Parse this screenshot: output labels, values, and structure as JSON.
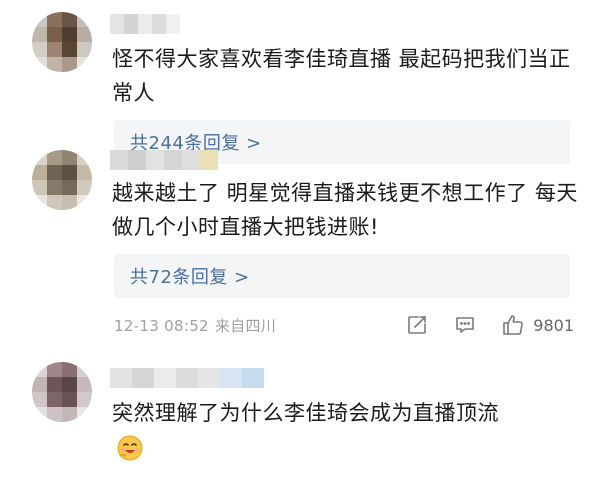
{
  "comments": [
    {
      "text": "怪不得大家喜欢看李佳琦直播 最起码把我们当正常人",
      "reply_link": "共244条回复 >"
    },
    {
      "text": "越来越土了  明星觉得直播来钱更不想工作了 每天做几个小时直播大把钱进账!",
      "reply_link": "共72条回复 >",
      "time": "12-13 08:52",
      "location": "来自四川",
      "like_count": "9801",
      "icons": {
        "share": "share-icon",
        "comment": "comment-icon",
        "like": "like-icon"
      }
    },
    {
      "text": "突然理解了为什么李佳琦会成为直播顶流",
      "emoji": "smiling-emoji-icon"
    }
  ],
  "colors": {
    "link": "#4a6fa0",
    "meta": "#a0a0a0",
    "reply_bg": "#f4f5f7"
  }
}
